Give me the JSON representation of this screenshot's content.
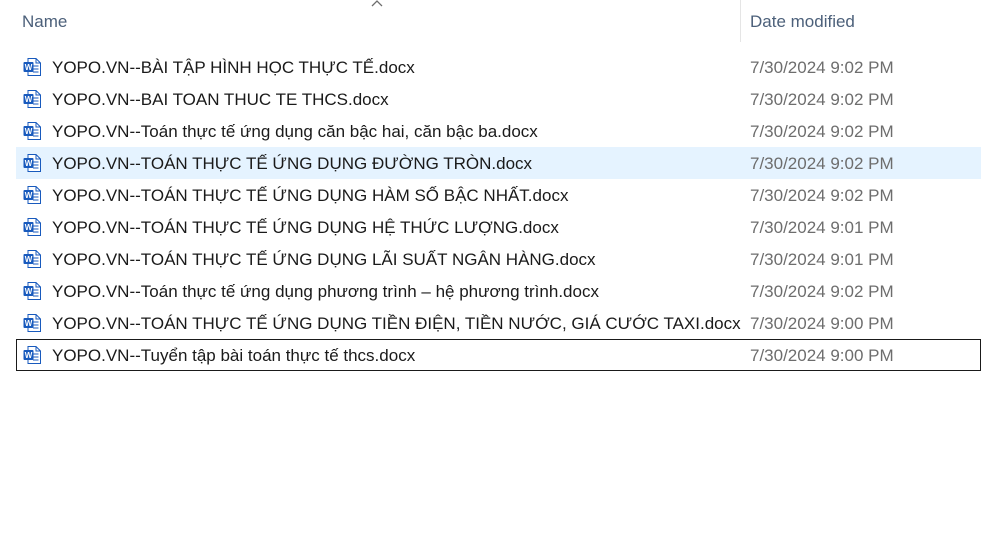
{
  "columns": {
    "name_label": "Name",
    "date_label": "Date modified",
    "sort": "ascending"
  },
  "colors": {
    "header_text": "#4c607a",
    "hover_row": "#e5f3ff",
    "word_icon_blue": "#185abd",
    "date_text": "#6d6d6d"
  },
  "files": [
    {
      "name": "YOPO.VN--BÀI TẬP HÌNH HỌC THỰC TẾ.docx",
      "date": "7/30/2024 9:02 PM",
      "icon": "word-document-icon"
    },
    {
      "name": "YOPO.VN--BAI TOAN THUC TE THCS.docx",
      "date": "7/30/2024 9:02 PM",
      "icon": "word-document-icon"
    },
    {
      "name": "YOPO.VN--Toán thực tế ứng dụng căn bậc hai, căn bậc ba.docx",
      "date": "7/30/2024 9:02 PM",
      "icon": "word-document-icon"
    },
    {
      "name": "YOPO.VN--TOÁN THỰC TẾ ỨNG DỤNG ĐƯỜNG TRÒN.docx",
      "date": "7/30/2024 9:02 PM",
      "icon": "word-document-icon",
      "state": "hover"
    },
    {
      "name": "YOPO.VN--TOÁN THỰC TẾ ỨNG DỤNG HÀM SỐ BẬC NHẤT.docx",
      "date": "7/30/2024 9:02 PM",
      "icon": "word-document-icon"
    },
    {
      "name": "YOPO.VN--TOÁN THỰC TẾ ỨNG DỤNG HỆ THỨC LƯỢNG.docx",
      "date": "7/30/2024 9:01 PM",
      "icon": "word-document-icon"
    },
    {
      "name": "YOPO.VN--TOÁN THỰC TẾ ỨNG DỤNG LÃI SUẤT NGÂN HÀNG.docx",
      "date": "7/30/2024 9:01 PM",
      "icon": "word-document-icon"
    },
    {
      "name": "YOPO.VN--Toán thực tế ứng dụng phương trình – hệ phương trình.docx",
      "date": "7/30/2024 9:02 PM",
      "icon": "word-document-icon"
    },
    {
      "name": "YOPO.VN--TOÁN THỰC TẾ ỨNG DỤNG TIỀN ĐIỆN, TIỀN NƯỚC, GIÁ CƯỚC TAXI.docx",
      "date": "7/30/2024 9:00 PM",
      "icon": "word-document-icon"
    },
    {
      "name": "YOPO.VN--Tuyển tập bài toán thực tế thcs.docx",
      "date": "7/30/2024 9:00 PM",
      "icon": "word-document-icon",
      "state": "focused"
    }
  ]
}
